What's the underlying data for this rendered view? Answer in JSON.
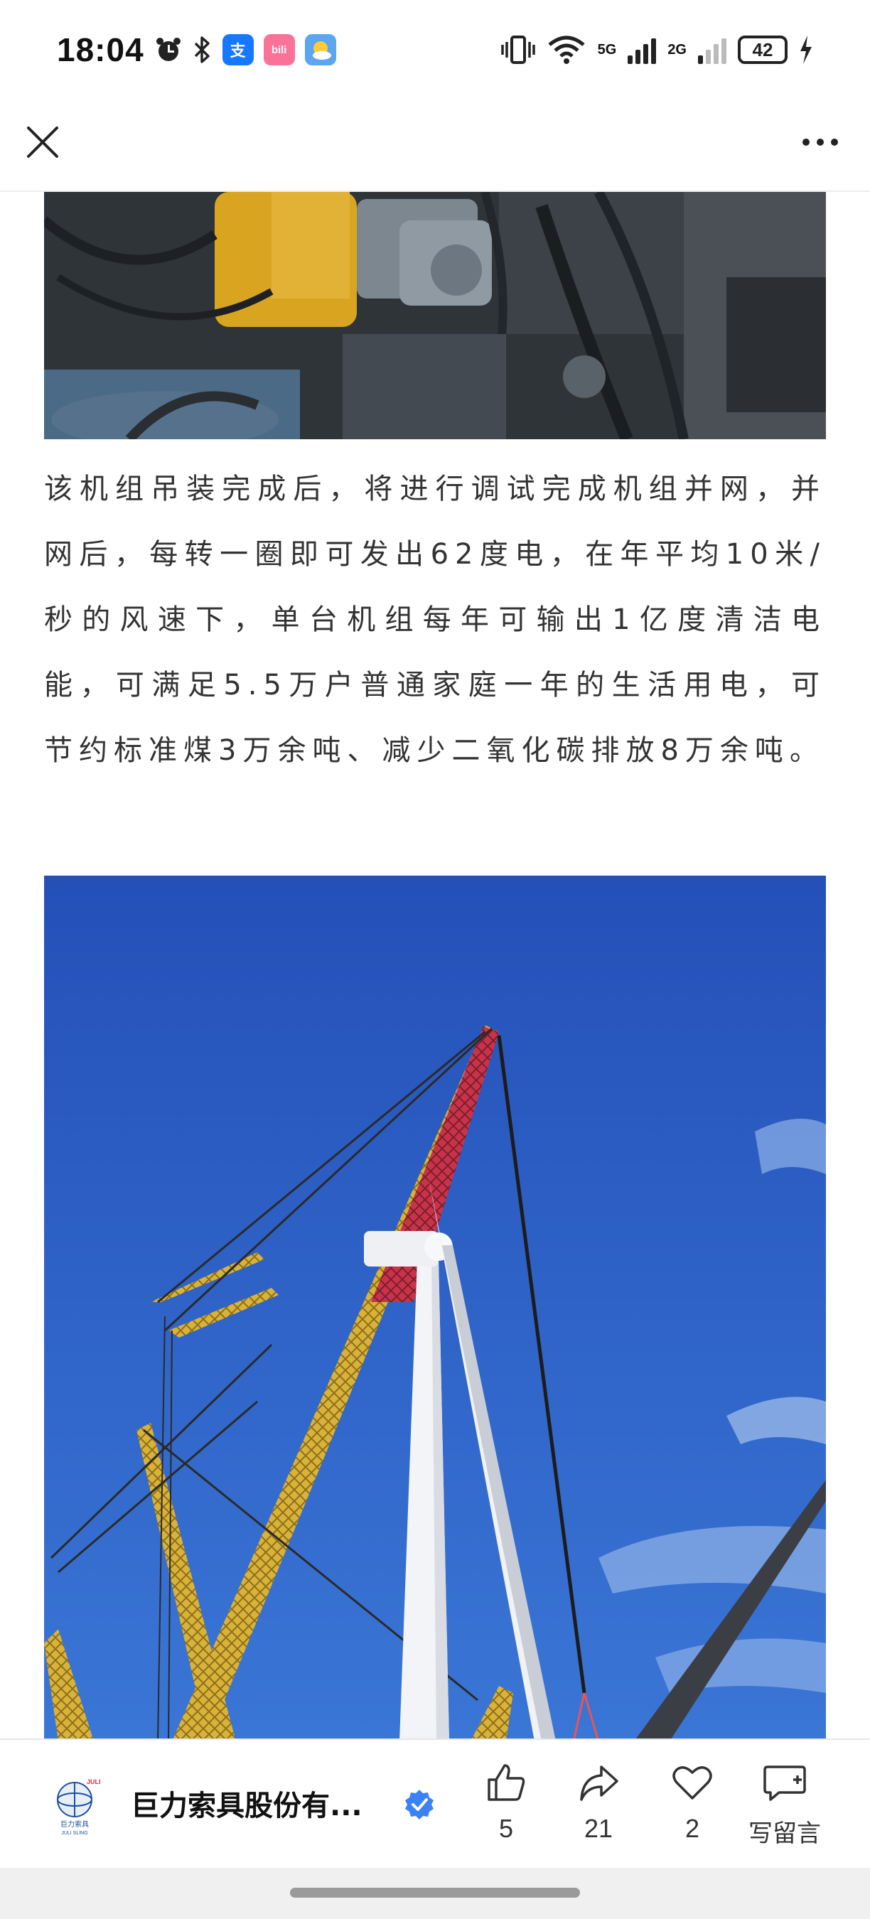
{
  "status_bar": {
    "time": "18:04",
    "app_icons": [
      "alarm-icon",
      "bluetooth-icon",
      "alipay-icon",
      "bilibili-icon",
      "weather-icon"
    ],
    "alipay_label": "支",
    "bilibili_label": "bili",
    "network_1": "5G",
    "network_2": "2G",
    "battery": "42"
  },
  "nav": {
    "close_icon": "close-icon",
    "more_icon": "more-icon"
  },
  "article": {
    "paragraph": "该机组吊装完成后，将进行调试完成机组并网，并网后，每转一圈即可发出62度电，在年平均10米/秒的风速下，单台机组每年可输出1亿度清洁电能，可满足5.5万户普通家庭一年的生活用电，可节约标准煤3万余吨、减少二氧化碳排放8万余吨。"
  },
  "bottom_bar": {
    "account_name": "巨力索具股份有...",
    "logo_text_top": "JULI",
    "logo_text_cn": "巨力索具",
    "logo_text_en": "JULI SLING",
    "like_count": "5",
    "share_count": "21",
    "favorite_count": "2",
    "comment_label": "写留言"
  },
  "colors": {
    "sky": "#2a5fc9",
    "crane_yellow": "#d9b23a",
    "crane_red": "#c8334a",
    "verified_blue": "#3b82f6"
  }
}
